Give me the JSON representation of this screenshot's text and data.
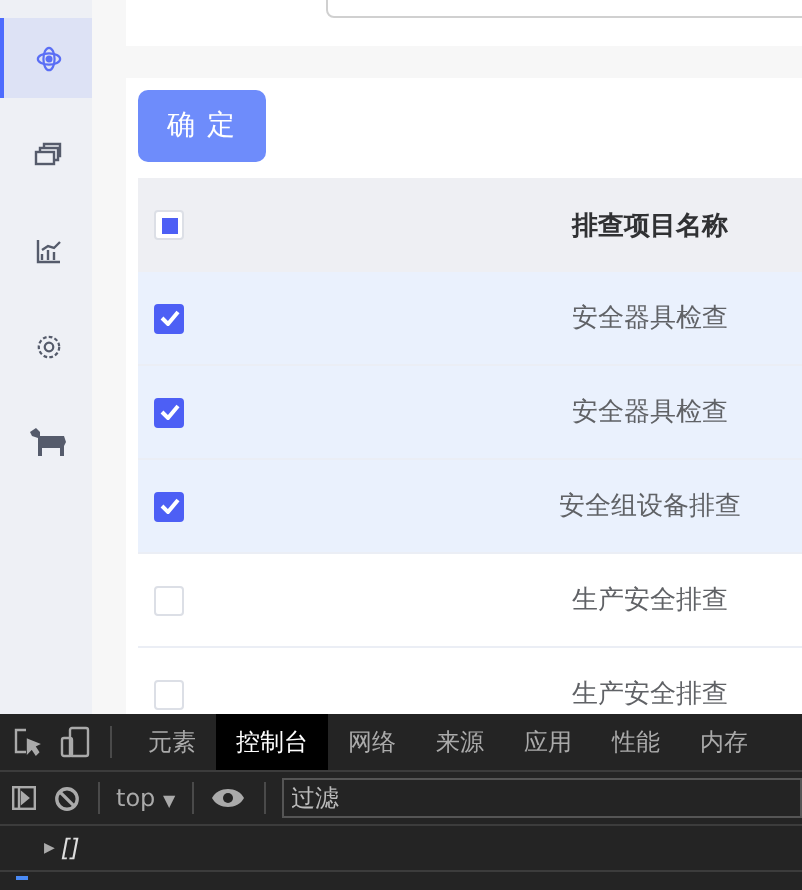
{
  "sidebar": {
    "items": [
      {
        "selected": true
      },
      {
        "selected": false
      },
      {
        "selected": false
      },
      {
        "selected": false
      },
      {
        "selected": false
      }
    ]
  },
  "confirm_button": "确 定",
  "table": {
    "select_all": {
      "indeterminate": true
    },
    "columns": [
      "排查项目名称"
    ],
    "rows": [
      {
        "name": "安全器具检查",
        "checked": true
      },
      {
        "name": "安全器具检查",
        "checked": true
      },
      {
        "name": "安全组设备排查",
        "checked": true
      },
      {
        "name": "生产安全排查",
        "checked": false
      },
      {
        "name": "生产安全排查",
        "checked": false
      }
    ]
  },
  "devtools": {
    "tabs": [
      {
        "label": "元素",
        "selected": false
      },
      {
        "label": "控制台",
        "selected": true
      },
      {
        "label": "网络",
        "selected": false
      },
      {
        "label": "来源",
        "selected": false
      },
      {
        "label": "应用",
        "selected": false
      },
      {
        "label": "性能",
        "selected": false
      },
      {
        "label": "内存",
        "selected": false
      }
    ],
    "context": "top",
    "context_caret": "▼",
    "filter_placeholder": "过滤",
    "console_lines": [
      {
        "arrow": "▶",
        "text": "[]"
      }
    ]
  }
}
